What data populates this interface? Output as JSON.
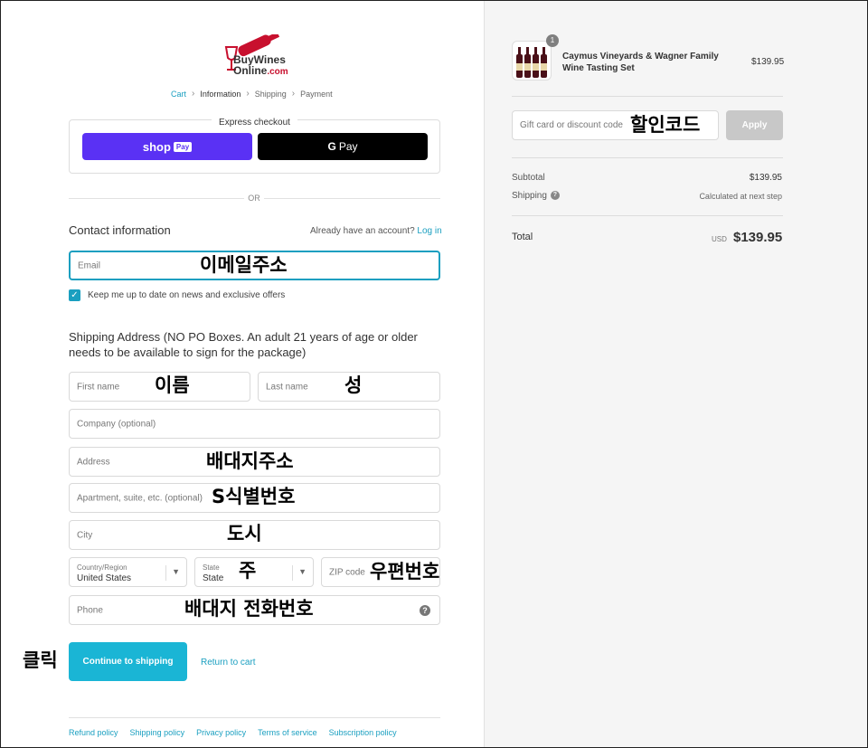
{
  "logo": {
    "line1": "BuyWines",
    "line2": "Online",
    "domain": ".com"
  },
  "breadcrumb": {
    "cart": "Cart",
    "information": "Information",
    "shipping": "Shipping",
    "payment": "Payment"
  },
  "express": {
    "title": "Express checkout",
    "shop_label": "shop",
    "shop_pay": "Pay",
    "gpay_g": "G",
    "gpay_label": "Pay"
  },
  "or_text": "OR",
  "contact": {
    "heading": "Contact information",
    "account_prompt": "Already have an account?",
    "login": "Log in",
    "email_placeholder": "Email",
    "email_annotation": "이메일주소",
    "newsletter_label": "Keep me up to date on news and exclusive offers"
  },
  "shipping": {
    "heading": "Shipping Address (NO PO Boxes. An adult 21 years of age or older needs to be available to sign for the package)",
    "first_name": "First name",
    "first_name_annotation": "이름",
    "last_name": "Last name",
    "last_name_annotation": "성",
    "company": "Company (optional)",
    "address": "Address",
    "address_annotation": "배대지주소",
    "apartment": "Apartment, suite, etc. (optional)",
    "apartment_annotation": "S식별번호",
    "city": "City",
    "city_annotation": "도시",
    "country_label": "Country/Region",
    "country_value": "United States",
    "state_label": "State",
    "state_value": "State",
    "state_annotation": "주",
    "zip": "ZIP code",
    "zip_annotation": "우편번호",
    "phone": "Phone",
    "phone_annotation": "배대지 전화번호"
  },
  "actions": {
    "click_annotation": "클릭",
    "continue": "Continue to shipping",
    "return": "Return to cart"
  },
  "footer": [
    "Refund policy",
    "Shipping policy",
    "Privacy policy",
    "Terms of service",
    "Subscription policy"
  ],
  "summary": {
    "badge": "1",
    "product_name": "Caymus Vineyards & Wagner Family Wine Tasting Set",
    "product_price": "$139.95",
    "discount_placeholder": "Gift card or discount code",
    "discount_annotation": "할인코드",
    "apply": "Apply",
    "subtotal_label": "Subtotal",
    "subtotal_value": "$139.95",
    "shipping_label": "Shipping",
    "shipping_value": "Calculated at next step",
    "total_label": "Total",
    "currency": "USD",
    "total_value": "$139.95"
  },
  "colors": {
    "accent": "#1a9fc0",
    "button": "#1ab5d5",
    "shop_pay": "#5a31f4"
  }
}
